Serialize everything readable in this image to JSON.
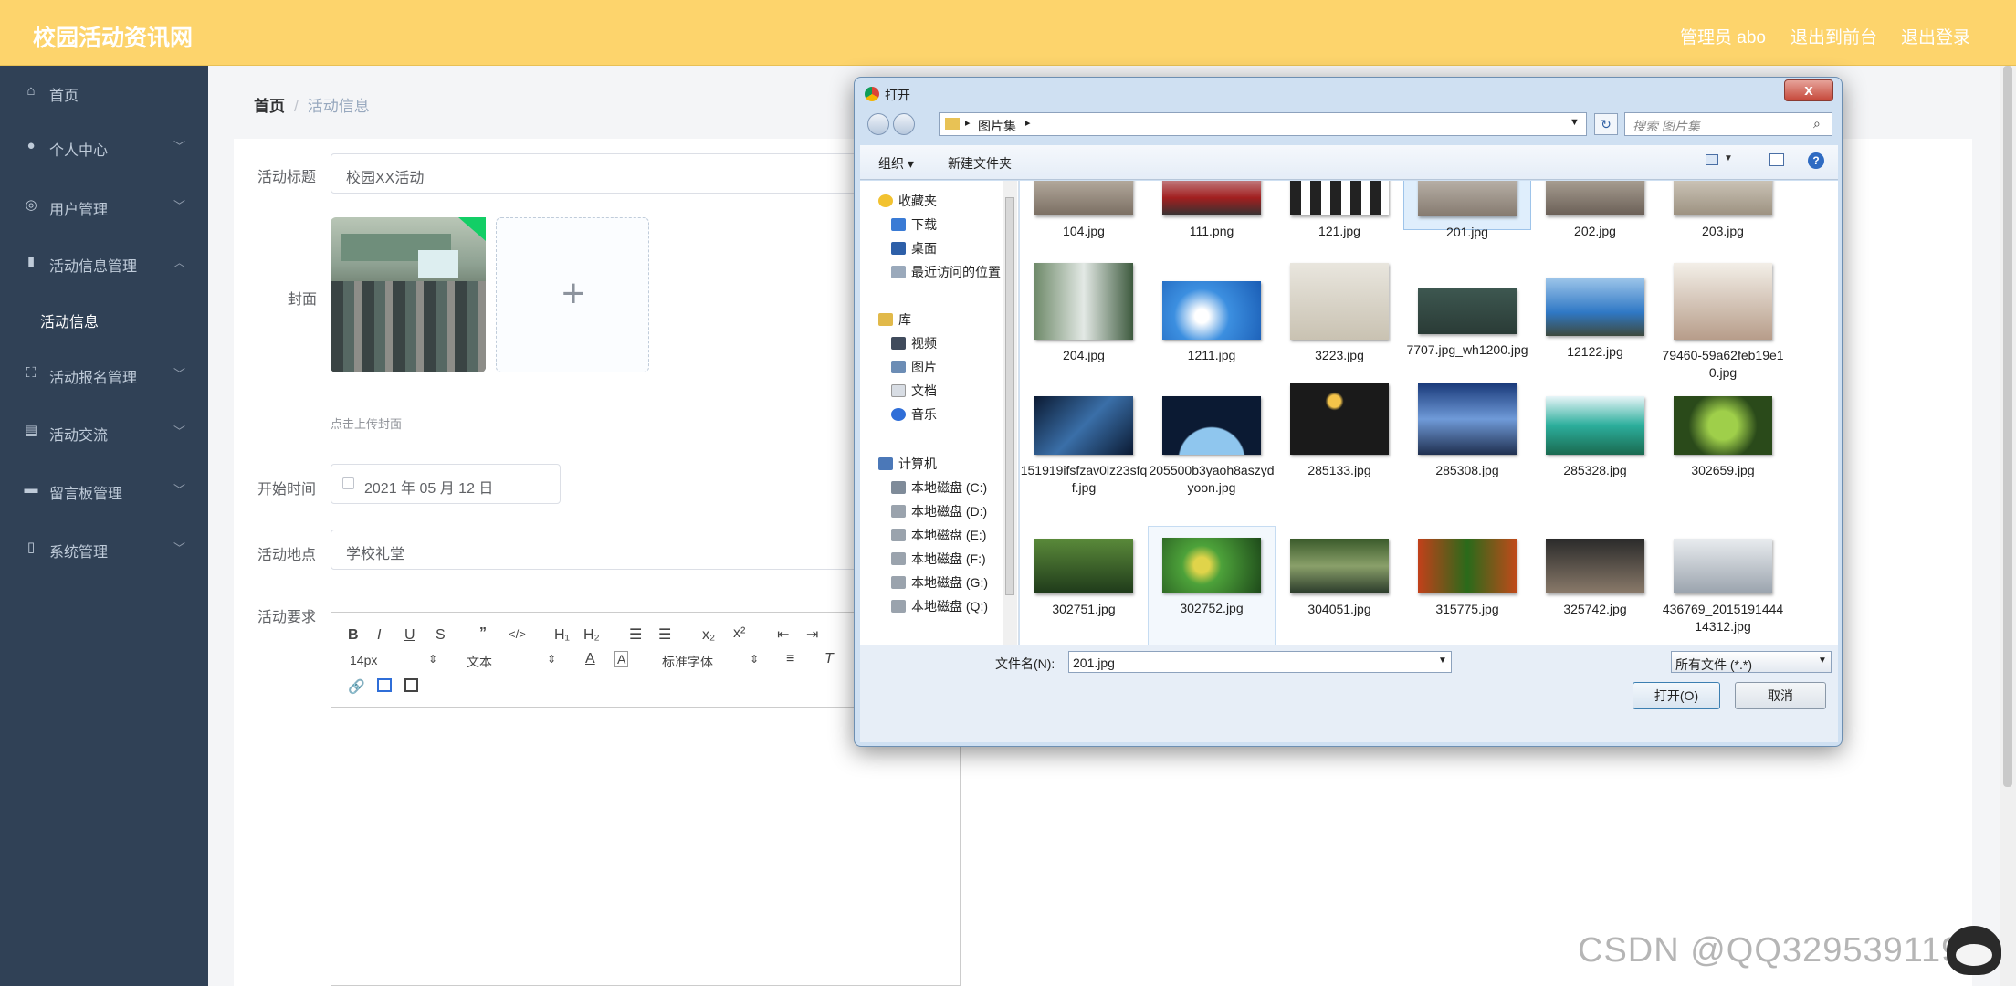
{
  "header": {
    "title": "校园活动资讯网",
    "user": "管理员 abo",
    "exit_front": "退出到前台",
    "logout": "退出登录"
  },
  "sidebar": {
    "items": [
      {
        "label": "首页",
        "icon": "home-icon"
      },
      {
        "label": "个人中心",
        "icon": "user-icon"
      },
      {
        "label": "用户管理",
        "icon": "users-icon"
      },
      {
        "label": "活动信息管理",
        "icon": "chart-icon"
      },
      {
        "label": "活动信息",
        "icon": ""
      },
      {
        "label": "活动报名管理",
        "icon": "frame-icon"
      },
      {
        "label": "活动交流",
        "icon": "clipboard-icon"
      },
      {
        "label": "留言板管理",
        "icon": "monitor-icon"
      },
      {
        "label": "系统管理",
        "icon": "phone-icon"
      }
    ]
  },
  "breadcrumb": {
    "home": "首页",
    "sep": "/",
    "current": "活动信息"
  },
  "form": {
    "title_label": "活动标题",
    "title_value": "校园XX活动",
    "cover_label": "封面",
    "upload_hint": "点击上传封面",
    "upload_plus": "+",
    "start_label": "开始时间",
    "start_value": "2021 年 05 月 12 日",
    "location_label": "活动地点",
    "location_value": "学校礼堂",
    "req_label": "活动要求"
  },
  "editor": {
    "size": "14px",
    "text_style": "文本",
    "font": "标准字体"
  },
  "dialog": {
    "title": "打开",
    "close": "x",
    "address": "图片集",
    "search_placeholder": "搜索 图片集",
    "organize": "组织 ▾",
    "new_folder": "新建文件夹",
    "nav": {
      "favorites": "收藏夹",
      "downloads": "下载",
      "desktop": "桌面",
      "recent": "最近访问的位置",
      "libraries": "库",
      "videos": "视频",
      "pictures": "图片",
      "documents": "文档",
      "music": "音乐",
      "computer": "计算机",
      "disks": [
        "本地磁盘 (C:)",
        "本地磁盘 (D:)",
        "本地磁盘 (E:)",
        "本地磁盘 (F:)",
        "本地磁盘 (G:)",
        "本地磁盘 (Q:)"
      ]
    },
    "files": [
      "104.jpg",
      "111.png",
      "121.jpg",
      "201.jpg",
      "202.jpg",
      "203.jpg",
      "204.jpg",
      "1211.jpg",
      "3223.jpg",
      "7707.jpg_wh1200.jpg",
      "12122.jpg",
      "79460-59a62feb19e10.jpg",
      "151919ifsfzav0lz23sfqf.jpg",
      "205500b3yaoh8aszydyoon.jpg",
      "285133.jpg",
      "285308.jpg",
      "285328.jpg",
      "302659.jpg",
      "302751.jpg",
      "302752.jpg",
      "304051.jpg",
      "315775.jpg",
      "325742.jpg",
      "436769_201519144414312.jpg"
    ],
    "filename_label": "文件名(N):",
    "filename_value": "201.jpg",
    "filter_value": "所有文件 (*.*)",
    "open_button": "打开(O)",
    "cancel_button": "取消"
  },
  "watermark": "CSDN @QQ3295391197"
}
